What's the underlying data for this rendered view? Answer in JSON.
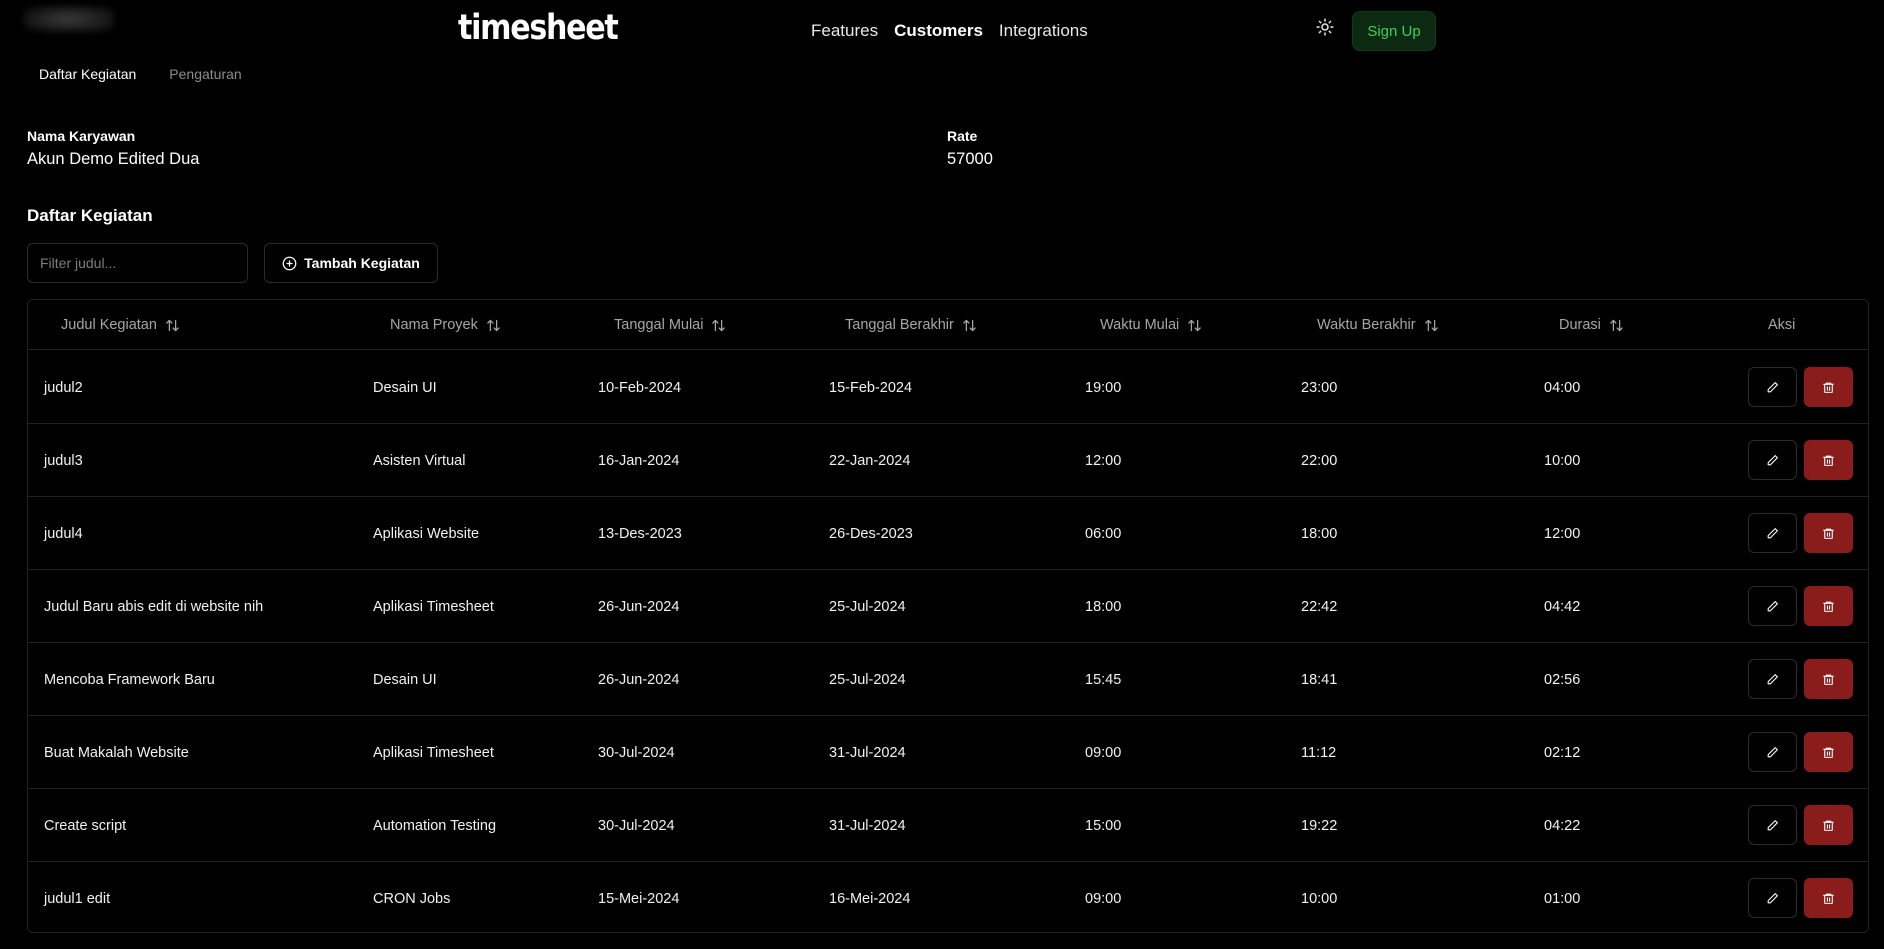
{
  "nav": {
    "brand": "timesheet",
    "links": [
      {
        "label": "Features",
        "active": false
      },
      {
        "label": "Customers",
        "active": true
      },
      {
        "label": "Integrations",
        "active": false
      }
    ],
    "signup_label": "Sign Up",
    "theme_icon": "sun-icon",
    "accent_color": "#3ccf5e"
  },
  "tabs": [
    {
      "label": "Daftar Kegiatan",
      "active": true
    },
    {
      "label": "Pengaturan",
      "active": false
    }
  ],
  "info": {
    "employee_label": "Nama Karyawan",
    "employee_value": "Akun Demo Edited Dua",
    "rate_label": "Rate",
    "rate_value": "57000"
  },
  "section_title": "Daftar Kegiatan",
  "filter": {
    "placeholder": "Filter judul..."
  },
  "add_button": {
    "label": "Tambah Kegiatan",
    "icon": "plus-circle-icon"
  },
  "table": {
    "headers": [
      {
        "label": "Judul Kegiatan",
        "sortable": true
      },
      {
        "label": "Nama Proyek",
        "sortable": true
      },
      {
        "label": "Tanggal Mulai",
        "sortable": true
      },
      {
        "label": "Tanggal Berakhir",
        "sortable": true
      },
      {
        "label": "Waktu Mulai",
        "sortable": true
      },
      {
        "label": "Waktu Berakhir",
        "sortable": true
      },
      {
        "label": "Durasi",
        "sortable": true
      },
      {
        "label": "Aksi",
        "sortable": false
      }
    ],
    "rows": [
      [
        "judul2",
        "Desain UI",
        "10-Feb-2024",
        "15-Feb-2024",
        "19:00",
        "23:00",
        "04:00"
      ],
      [
        "judul3",
        "Asisten Virtual",
        "16-Jan-2024",
        "22-Jan-2024",
        "12:00",
        "22:00",
        "10:00"
      ],
      [
        "judul4",
        "Aplikasi Website",
        "13-Des-2023",
        "26-Des-2023",
        "06:00",
        "18:00",
        "12:00"
      ],
      [
        "Judul Baru abis edit di website nih",
        "Aplikasi Timesheet",
        "26-Jun-2024",
        "25-Jul-2024",
        "18:00",
        "22:42",
        "04:42"
      ],
      [
        "Mencoba Framework Baru",
        "Desain UI",
        "26-Jun-2024",
        "25-Jul-2024",
        "15:45",
        "18:41",
        "02:56"
      ],
      [
        "Buat Makalah Website",
        "Aplikasi Timesheet",
        "30-Jul-2024",
        "31-Jul-2024",
        "09:00",
        "11:12",
        "02:12"
      ],
      [
        "Create script",
        "Automation Testing",
        "30-Jul-2024",
        "31-Jul-2024",
        "15:00",
        "19:22",
        "04:22"
      ],
      [
        "judul1 edit",
        "CRON Jobs",
        "15-Mei-2024",
        "16-Mei-2024",
        "09:00",
        "10:00",
        "01:00"
      ]
    ],
    "action_icons": {
      "edit": "pencil-icon",
      "delete": "trash-icon"
    },
    "delete_color": "#8b1c1c"
  }
}
